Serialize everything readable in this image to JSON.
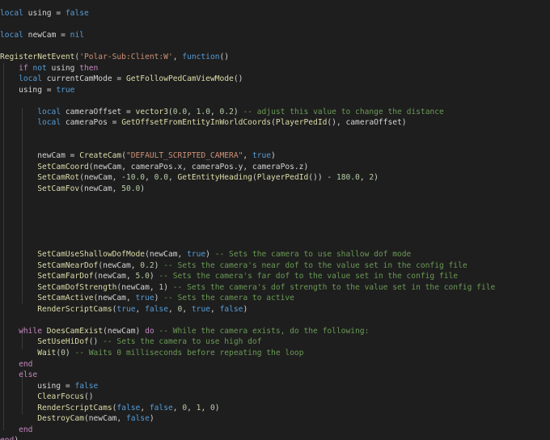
{
  "editor": {
    "language": "lua",
    "theme_colors": {
      "background": "#1e1e1e",
      "keyword": "#c586c0",
      "function": "#dcdcaa",
      "string": "#ce9178",
      "number": "#b5cea8",
      "comment": "#6a9955",
      "text": "#d4d4d4",
      "constant": "#569cd6"
    },
    "lines": [
      [
        [
          "kw2",
          "local"
        ],
        [
          "var",
          " using "
        ],
        [
          "pun",
          "= "
        ],
        [
          "bool",
          "false"
        ]
      ],
      [],
      [
        [
          "kw2",
          "local"
        ],
        [
          "var",
          " newCam "
        ],
        [
          "pun",
          "= "
        ],
        [
          "bool",
          "nil"
        ]
      ],
      [],
      [
        [
          "fn",
          "RegisterNetEvent"
        ],
        [
          "pun",
          "("
        ],
        [
          "str",
          "'Polar-Sub:Client:W'"
        ],
        [
          "pun",
          ", "
        ],
        [
          "kw2",
          "function"
        ],
        [
          "pun",
          "()"
        ]
      ],
      [
        [
          "var",
          "    "
        ],
        [
          "kw",
          "if"
        ],
        [
          "kw2",
          " not"
        ],
        [
          "var",
          " using "
        ],
        [
          "kw",
          "then"
        ]
      ],
      [
        [
          "var",
          "    "
        ],
        [
          "kw2",
          "local"
        ],
        [
          "var",
          " currentCamMode "
        ],
        [
          "pun",
          "= "
        ],
        [
          "fn",
          "GetFollowPedCamViewMode"
        ],
        [
          "pun",
          "()"
        ]
      ],
      [
        [
          "var",
          "    using "
        ],
        [
          "pun",
          "= "
        ],
        [
          "bool",
          "true"
        ]
      ],
      [],
      [
        [
          "var",
          "        "
        ],
        [
          "kw2",
          "local"
        ],
        [
          "var",
          " cameraOffset "
        ],
        [
          "pun",
          "= "
        ],
        [
          "fn",
          "vector3"
        ],
        [
          "pun",
          "("
        ],
        [
          "num",
          "0.0"
        ],
        [
          "pun",
          ", "
        ],
        [
          "num",
          "1.0"
        ],
        [
          "pun",
          ", "
        ],
        [
          "num",
          "0.2"
        ],
        [
          "pun",
          ") "
        ],
        [
          "cm",
          "-- adjust this value to change the distance"
        ]
      ],
      [
        [
          "var",
          "        "
        ],
        [
          "kw2",
          "local"
        ],
        [
          "var",
          " cameraPos "
        ],
        [
          "pun",
          "= "
        ],
        [
          "fn",
          "GetOffsetFromEntityInWorldCoords"
        ],
        [
          "pun",
          "("
        ],
        [
          "fn",
          "PlayerPedId"
        ],
        [
          "pun",
          "(), cameraOffset)"
        ]
      ],
      [],
      [],
      [
        [
          "var",
          "        newCam "
        ],
        [
          "pun",
          "= "
        ],
        [
          "fn",
          "CreateCam"
        ],
        [
          "pun",
          "("
        ],
        [
          "str",
          "\"DEFAULT_SCRIPTED_CAMERA\""
        ],
        [
          "pun",
          ", "
        ],
        [
          "bool",
          "true"
        ],
        [
          "pun",
          ")"
        ]
      ],
      [
        [
          "var",
          "        "
        ],
        [
          "fn",
          "SetCamCoord"
        ],
        [
          "pun",
          "(newCam, cameraPos.x, cameraPos.y, cameraPos.z)"
        ]
      ],
      [
        [
          "var",
          "        "
        ],
        [
          "fn",
          "SetCamRot"
        ],
        [
          "pun",
          "(newCam, -"
        ],
        [
          "num",
          "10.0"
        ],
        [
          "pun",
          ", "
        ],
        [
          "num",
          "0.0"
        ],
        [
          "pun",
          ", "
        ],
        [
          "fn",
          "GetEntityHeading"
        ],
        [
          "pun",
          "("
        ],
        [
          "fn",
          "PlayerPedId"
        ],
        [
          "pun",
          "()) - "
        ],
        [
          "num",
          "180.0"
        ],
        [
          "pun",
          ", "
        ],
        [
          "num",
          "2"
        ],
        [
          "pun",
          ")"
        ]
      ],
      [
        [
          "var",
          "        "
        ],
        [
          "fn",
          "SetCamFov"
        ],
        [
          "pun",
          "(newCam, "
        ],
        [
          "num",
          "50.0"
        ],
        [
          "pun",
          ")"
        ]
      ],
      [],
      [],
      [],
      [],
      [],
      [
        [
          "var",
          "        "
        ],
        [
          "fn",
          "SetCamUseShallowDofMode"
        ],
        [
          "pun",
          "(newCam, "
        ],
        [
          "bool",
          "true"
        ],
        [
          "pun",
          ") "
        ],
        [
          "cm",
          "-- Sets the camera to use shallow dof mode"
        ]
      ],
      [
        [
          "var",
          "        "
        ],
        [
          "fn",
          "SetCamNearDof"
        ],
        [
          "pun",
          "(newCam, "
        ],
        [
          "num",
          "0.2"
        ],
        [
          "pun",
          ") "
        ],
        [
          "cm",
          "-- Sets the camera's near dof to the value set in the config file"
        ]
      ],
      [
        [
          "var",
          "        "
        ],
        [
          "fn",
          "SetCamFarDof"
        ],
        [
          "pun",
          "(newCam, "
        ],
        [
          "num",
          "5.0"
        ],
        [
          "pun",
          ") "
        ],
        [
          "cm",
          "-- Sets the camera's far dof to the value set in the config file"
        ]
      ],
      [
        [
          "var",
          "        "
        ],
        [
          "fn",
          "SetCamDofStrength"
        ],
        [
          "pun",
          "(newCam, "
        ],
        [
          "num",
          "1"
        ],
        [
          "pun",
          ") "
        ],
        [
          "cm",
          "-- Sets the camera's dof strength to the value set in the config file"
        ]
      ],
      [
        [
          "var",
          "        "
        ],
        [
          "fn",
          "SetCamActive"
        ],
        [
          "pun",
          "(newCam, "
        ],
        [
          "bool",
          "true"
        ],
        [
          "pun",
          ") "
        ],
        [
          "cm",
          "-- Sets the camera to active"
        ]
      ],
      [
        [
          "var",
          "        "
        ],
        [
          "fn",
          "RenderScriptCams"
        ],
        [
          "pun",
          "("
        ],
        [
          "bool",
          "true"
        ],
        [
          "pun",
          ", "
        ],
        [
          "bool",
          "false"
        ],
        [
          "pun",
          ", "
        ],
        [
          "num",
          "0"
        ],
        [
          "pun",
          ", "
        ],
        [
          "bool",
          "true"
        ],
        [
          "pun",
          ", "
        ],
        [
          "bool",
          "false"
        ],
        [
          "pun",
          ")"
        ]
      ],
      [],
      [
        [
          "var",
          "    "
        ],
        [
          "kw",
          "while"
        ],
        [
          "var",
          " "
        ],
        [
          "fn",
          "DoesCamExist"
        ],
        [
          "pun",
          "(newCam) "
        ],
        [
          "kw",
          "do"
        ],
        [
          "var",
          " "
        ],
        [
          "cm",
          "-- While the camera exists, do the following:"
        ]
      ],
      [
        [
          "var",
          "        "
        ],
        [
          "fn",
          "SetUseHiDof"
        ],
        [
          "pun",
          "() "
        ],
        [
          "cm",
          "-- Sets the camera to use high dof"
        ]
      ],
      [
        [
          "var",
          "        "
        ],
        [
          "fn",
          "Wait"
        ],
        [
          "pun",
          "("
        ],
        [
          "num",
          "0"
        ],
        [
          "pun",
          ") "
        ],
        [
          "cm",
          "-- Waits 0 milliseconds before repeating the loop"
        ]
      ],
      [
        [
          "var",
          "    "
        ],
        [
          "kw",
          "end"
        ]
      ],
      [
        [
          "var",
          "    "
        ],
        [
          "kw",
          "else"
        ]
      ],
      [
        [
          "var",
          "        using "
        ],
        [
          "pun",
          "= "
        ],
        [
          "bool",
          "false"
        ]
      ],
      [
        [
          "var",
          "        "
        ],
        [
          "fn",
          "ClearFocus"
        ],
        [
          "pun",
          "()"
        ]
      ],
      [
        [
          "var",
          "        "
        ],
        [
          "fn",
          "RenderScriptCams"
        ],
        [
          "pun",
          "("
        ],
        [
          "bool",
          "false"
        ],
        [
          "pun",
          ", "
        ],
        [
          "bool",
          "false"
        ],
        [
          "pun",
          ", "
        ],
        [
          "num",
          "0"
        ],
        [
          "pun",
          ", "
        ],
        [
          "num",
          "1"
        ],
        [
          "pun",
          ", "
        ],
        [
          "num",
          "0"
        ],
        [
          "pun",
          ")"
        ]
      ],
      [
        [
          "var",
          "        "
        ],
        [
          "fn",
          "DestroyCam"
        ],
        [
          "pun",
          "(newCam, "
        ],
        [
          "bool",
          "false"
        ],
        [
          "pun",
          ")"
        ]
      ],
      [
        [
          "var",
          "    "
        ],
        [
          "kw",
          "end"
        ]
      ],
      [
        [
          "kw",
          "end"
        ],
        [
          "pun",
          ")"
        ]
      ]
    ]
  }
}
